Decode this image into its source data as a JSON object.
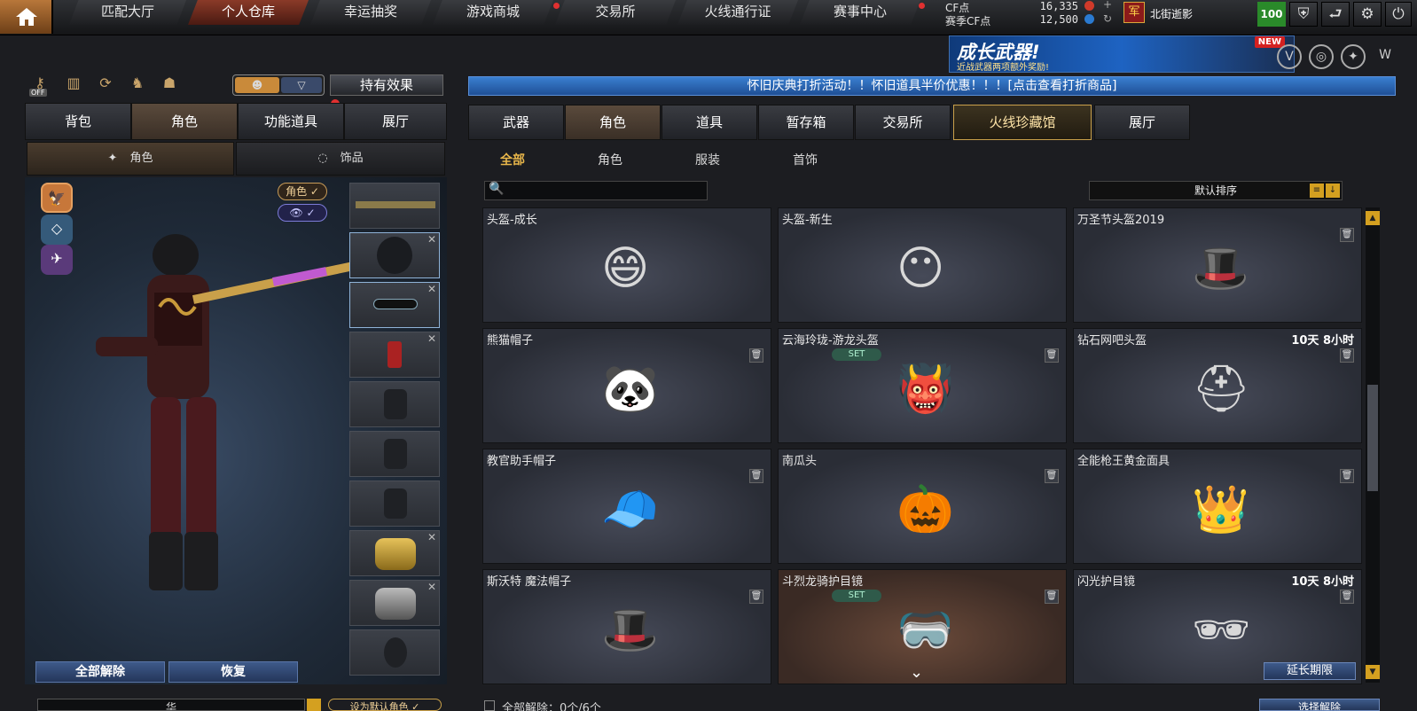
{
  "topnav": {
    "tabs": [
      "匹配大厅",
      "个人仓库",
      "幸运抽奖",
      "游戏商城",
      "交易所",
      "火线通行证",
      "赛事中心"
    ],
    "active": "个人仓库"
  },
  "currency": {
    "cf_label": "CF点",
    "cf_value": "16,335",
    "season_label": "赛季CF点",
    "season_value": "12,500"
  },
  "user": {
    "rank_icon": "军",
    "name": "北街逝影",
    "level": "100"
  },
  "banner": {
    "title": "成长武器!",
    "subtitle": "近战武器两项额外奖励!",
    "badge": "NEW"
  },
  "left": {
    "off_label": "OFF",
    "holding_effect": "持有效果",
    "tabs": [
      "背包",
      "角色",
      "功能道具",
      "展厅"
    ],
    "subtabs": [
      "角色",
      "饰品"
    ],
    "role_pill": "角色 ✓",
    "eye_pill": "👁 ✓",
    "buttons": {
      "unequip_all": "全部解除",
      "restore": "恢复"
    },
    "bottom": {
      "char_name": "华",
      "set_default": "设为默认角色 ✓"
    }
  },
  "right": {
    "promo": "怀旧庆典打折活动！！怀旧道具半价优惠！！！[点击查看打折商品]",
    "tabs": [
      "武器",
      "角色",
      "道具",
      "暂存箱",
      "交易所",
      "火线珍藏馆",
      "展厅"
    ],
    "filters": [
      "全部",
      "角色",
      "服装",
      "首饰"
    ],
    "sort_label": "默认排序",
    "items": [
      {
        "name": "头盔-成长",
        "time": "",
        "set": false,
        "trash": false,
        "icon": "😄"
      },
      {
        "name": "头盔-新生",
        "time": "",
        "set": false,
        "trash": false,
        "icon": "😶"
      },
      {
        "name": "万圣节头盔2019",
        "time": "",
        "set": false,
        "trash": true,
        "icon": "🎩"
      },
      {
        "name": "熊猫帽子",
        "time": "",
        "set": false,
        "trash": true,
        "icon": "🐼"
      },
      {
        "name": "云海玲珑-游龙头盔",
        "time": "",
        "set": true,
        "trash": true,
        "icon": "👹"
      },
      {
        "name": "钻石网吧头盔",
        "time": "10天 8小时",
        "set": false,
        "trash": true,
        "icon": "⛑"
      },
      {
        "name": "教官助手帽子",
        "time": "",
        "set": false,
        "trash": true,
        "icon": "🧢"
      },
      {
        "name": "南瓜头",
        "time": "",
        "set": false,
        "trash": true,
        "icon": "🎃"
      },
      {
        "name": "全能枪王黄金面具",
        "time": "",
        "set": false,
        "trash": true,
        "icon": "👑"
      },
      {
        "name": "斯沃特 魔法帽子",
        "time": "",
        "set": false,
        "trash": true,
        "icon": "🎩"
      },
      {
        "name": "斗烈龙骑护目镜",
        "time": "",
        "set": true,
        "trash": true,
        "icon": "🥽"
      },
      {
        "name": "闪光护目镜",
        "time": "10天 8小时",
        "set": false,
        "trash": true,
        "icon": "🕶",
        "extend": "延长期限"
      }
    ],
    "set_label": "SET",
    "bottom": {
      "unequip_all": "全部解除：0个/6个",
      "select_unequip": "选择解除"
    }
  },
  "colors": {
    "accent": "#d4a020",
    "blue_btn": "#3e5a8a",
    "active_nav": "#8a3a28"
  }
}
